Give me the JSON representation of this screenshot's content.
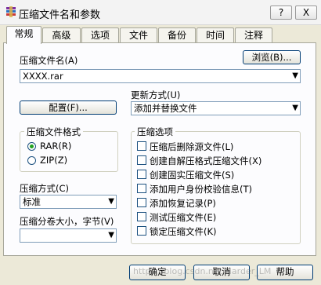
{
  "window": {
    "title": "压缩文件名和参数",
    "help_btn": "?",
    "close_btn": "X"
  },
  "tabs": [
    {
      "label": "常规"
    },
    {
      "label": "高级"
    },
    {
      "label": "选项"
    },
    {
      "label": "文件"
    },
    {
      "label": "备份"
    },
    {
      "label": "时间"
    },
    {
      "label": "注释"
    }
  ],
  "general": {
    "archive_name_label": "压缩文件名(A)",
    "browse_button": "浏览(B)...",
    "archive_name_value": "XXXX.rar",
    "update_mode_label": "更新方式(U)",
    "update_mode_value": "添加并替换文件",
    "profiles_button": "配置(F)...",
    "format_group": {
      "title": "压缩文件格式",
      "rar": "RAR(R)",
      "zip": "ZIP(Z)"
    },
    "method_label": "压缩方式(C)",
    "method_value": "标准",
    "split_label": "压缩分卷大小，字节(V)",
    "split_value": "",
    "options_group": {
      "title": "压缩选项",
      "items": [
        "压缩后删除源文件(L)",
        "创建自解压格式压缩文件(X)",
        "创建固实压缩文件(S)",
        "添加用户身份校验信息(T)",
        "添加恢复记录(P)",
        "测试压缩文件(E)",
        "锁定压缩文件(K)"
      ]
    }
  },
  "footer": {
    "ok": "确定",
    "cancel": "取消",
    "help": "帮助",
    "watermark": "https://blog.csdn.net/Harder_LM"
  }
}
